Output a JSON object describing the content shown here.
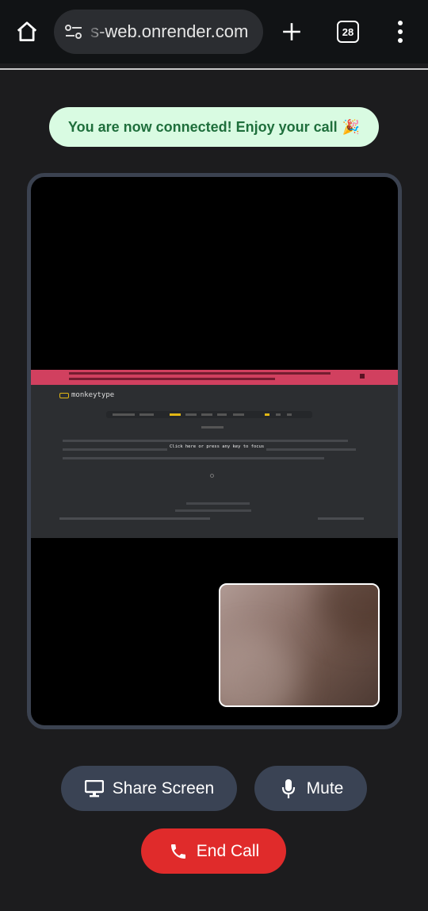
{
  "browser": {
    "url": "s-web.onrender.com",
    "tab_count": "28",
    "icons": [
      "home-icon",
      "tune-icon",
      "plus-icon",
      "tabs-icon",
      "more-vert-icon"
    ]
  },
  "status": {
    "message": "You are now connected! Enjoy your call",
    "emoji": "🎉",
    "color": "#1f6f3c",
    "background": "#d9fbe2"
  },
  "call": {
    "shared_screen_app": "monkeytype",
    "shared_screen_hint": "Click here or press any key to focus"
  },
  "controls": {
    "share_label": "Share Screen",
    "mute_label": "Mute",
    "end_label": "End Call",
    "end_color": "#e02b2b",
    "button_color": "#3a4354"
  }
}
